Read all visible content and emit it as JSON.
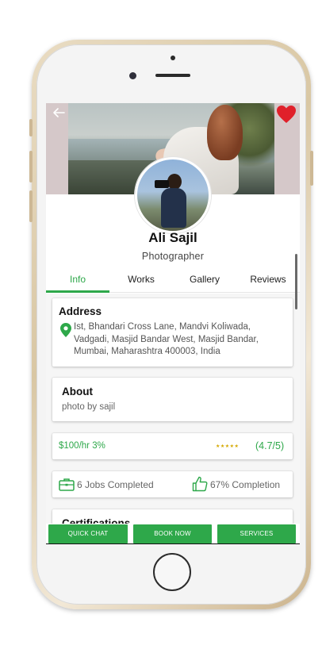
{
  "profile": {
    "name": "Ali Sajil",
    "role": "Photographer"
  },
  "tabs": [
    {
      "label": "Info",
      "active": true
    },
    {
      "label": "Works",
      "active": false
    },
    {
      "label": "Gallery",
      "active": false
    },
    {
      "label": "Reviews",
      "active": false
    }
  ],
  "address": {
    "title": "Address",
    "text": "Ist, Bhandari Cross Lane, Mandvi Koliwada, Vadgadi, Masjid Bandar West, Masjid Bandar, Mumbai, Maharashtra 400003, India"
  },
  "about": {
    "title": "About",
    "text": "photo by sajil"
  },
  "rate": {
    "text": "$100/hr 3%",
    "stars": "★★★★★",
    "rating_value": 4.7,
    "rating_label": "(4.7/5)"
  },
  "stats": {
    "jobs_label": "6 Jobs Completed",
    "completion_label": "67% Completion"
  },
  "certifications": {
    "title": "Certifications"
  },
  "actions": {
    "quick_chat": "QUICK CHAT",
    "book_now": "BOOK NOW",
    "services": "SERVICES"
  },
  "icons": {
    "back": "back-arrow-icon",
    "favorite": "heart-icon",
    "location": "location-pin-icon",
    "jobs": "briefcase-icon",
    "completion": "thumbs-up-icon"
  },
  "colors": {
    "accent": "#2ea84a",
    "favorite": "#e0202a",
    "stars": "#d4a800"
  }
}
